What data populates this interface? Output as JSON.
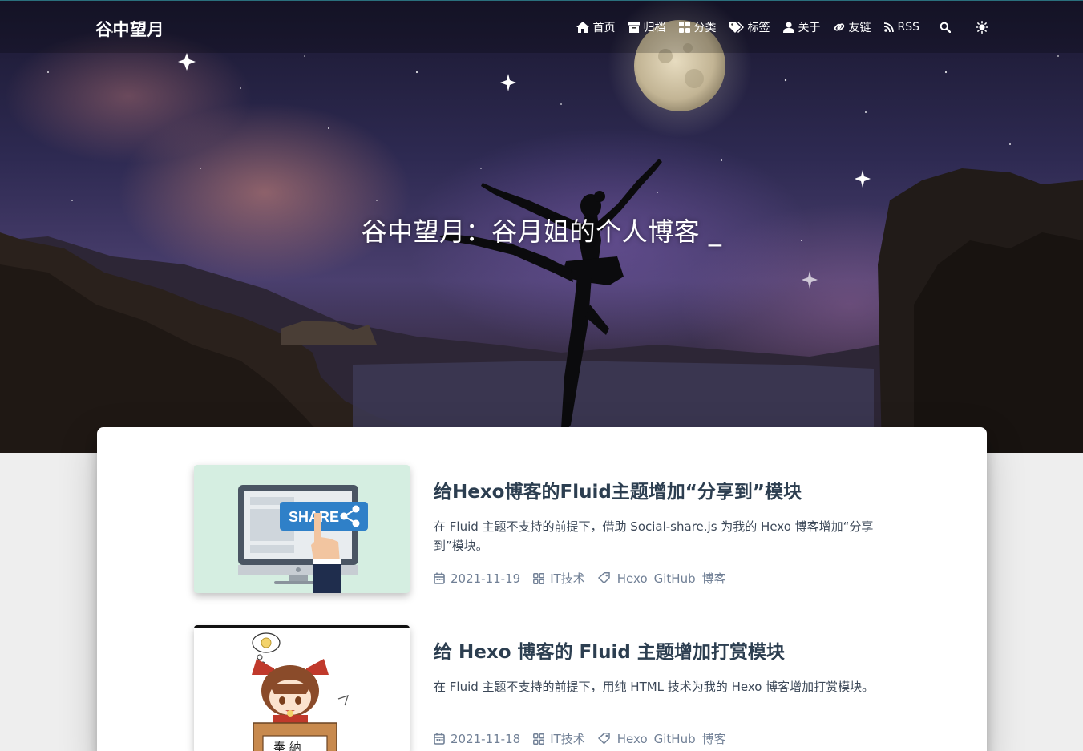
{
  "site": {
    "brand": "谷中望月"
  },
  "nav": {
    "items": [
      {
        "label": "首页",
        "icon": "home-icon"
      },
      {
        "label": "归档",
        "icon": "archive-icon"
      },
      {
        "label": "分类",
        "icon": "category-icon"
      },
      {
        "label": "标签",
        "icon": "tags-icon"
      },
      {
        "label": "关于",
        "icon": "user-icon"
      },
      {
        "label": "友链",
        "icon": "link-icon"
      },
      {
        "label": "RSS",
        "icon": "rss-icon"
      }
    ],
    "search_icon": "search-icon",
    "theme_icon": "sun-icon"
  },
  "hero": {
    "title": "谷中望月：谷月姐的个人博客 _"
  },
  "posts": [
    {
      "title": "给Hexo博客的Fluid主题增加“分享到”模块",
      "excerpt": "在 Fluid 主题不支持的前提下，借助 Social-share.js 为我的 Hexo 博客增加“分享到”模块。",
      "date": "2021-11-19",
      "category": "IT技术",
      "tags": [
        "Hexo",
        "GitHub",
        "博客"
      ],
      "thumb_text": "SHARE"
    },
    {
      "title": "给 Hexo 博客的 Fluid 主题增加打赏模块",
      "excerpt": "在 Fluid 主题不支持的前提下，用纯 HTML 技术为我的 Hexo 博客增加打赏模块。",
      "date": "2021-11-18",
      "category": "IT技术",
      "tags": [
        "Hexo",
        "GitHub",
        "博客"
      ],
      "thumb_text": "奉 納"
    }
  ],
  "colors": {
    "title": "#2c3e50",
    "text": "#3c4858",
    "meta": "#718096",
    "page_bg": "#eeeeee",
    "share_button": "#2f80c8"
  }
}
